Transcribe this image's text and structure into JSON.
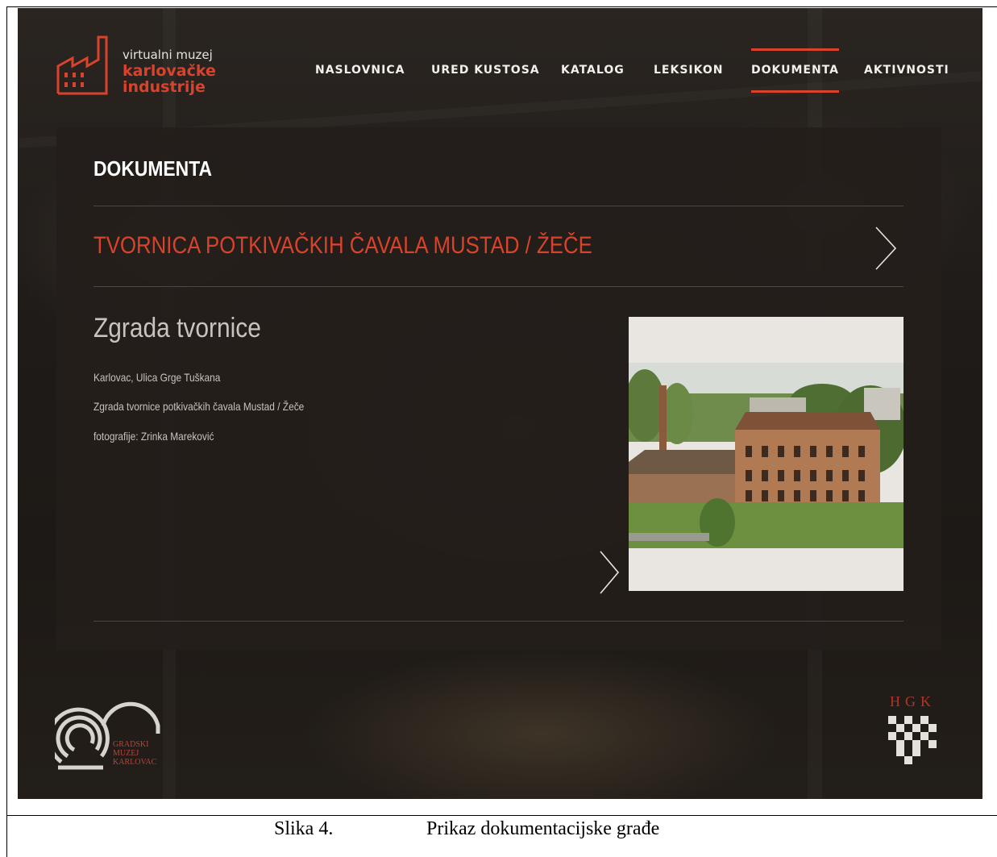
{
  "logo": {
    "line1": "virtualni muzej",
    "line2": "karlovačke",
    "line3": "industrije",
    "accent_color": "#d9432b"
  },
  "nav": {
    "items": [
      {
        "label": "NASLOVNICA"
      },
      {
        "label": "URED KUSTOSA"
      },
      {
        "label": "KATALOG"
      },
      {
        "label": "LEKSIKON"
      },
      {
        "label": "DOKUMENTA",
        "active": true
      },
      {
        "label": "AKTIVNOSTI"
      }
    ]
  },
  "content": {
    "page_title": "DOKUMENTA",
    "collection_title": "TVORNICA POTKIVAČKIH ČAVALA MUSTAD / ŽEČE",
    "item": {
      "title": "Zgrada tvornice",
      "location": "Karlovac, Ulica Grge Tuškana",
      "description": "Zgrada tvornice potkivačkih čavala Mustad / Žeče",
      "credit": "fotografije: Zrinka Mareković"
    }
  },
  "footer": {
    "museum_logo_text": [
      "GRADSKI",
      "MUZEJ",
      "KARLOVAC"
    ],
    "hgk_letters": "HGK"
  },
  "caption": {
    "number": "Slika 4.",
    "text": "Prikaz dokumentacijske građe"
  },
  "colors": {
    "accent": "#d9432b",
    "panel": "#231e1b",
    "text_light": "#f3f0ec"
  }
}
